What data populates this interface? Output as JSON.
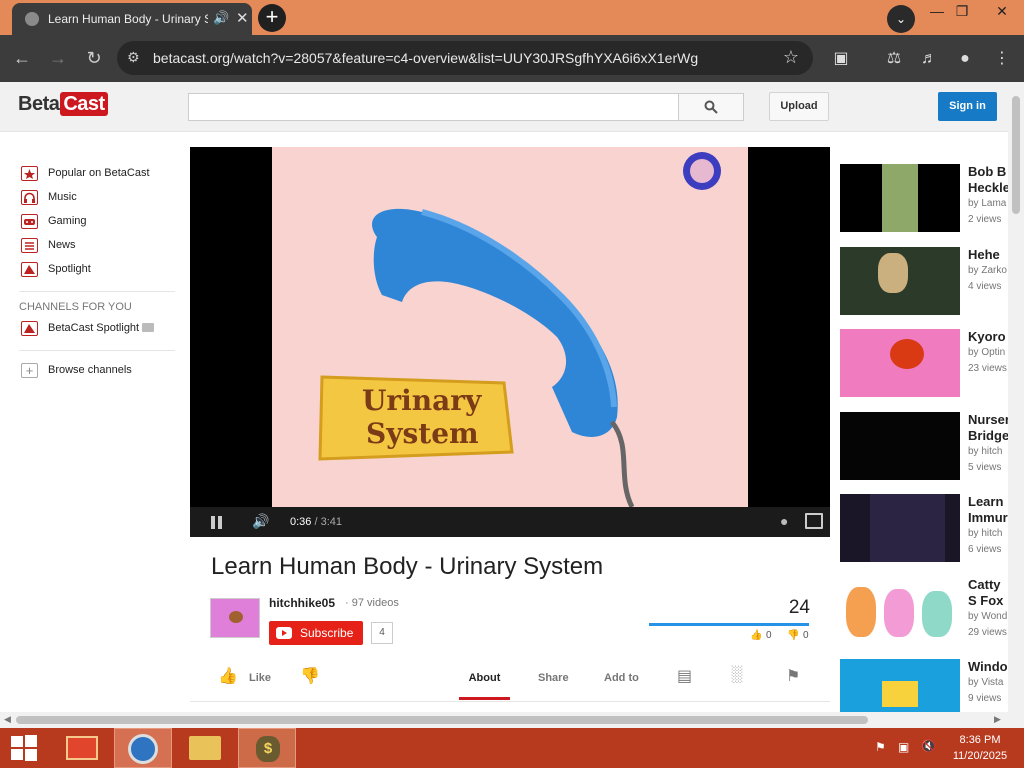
{
  "browser": {
    "tab_title": "Learn Human Body - Urinary System",
    "url": "betacast.org/watch?v=28057&feature=c4-overview&list=UUY30JRSgfhYXA6i6xX1erWg"
  },
  "site": {
    "logo_beta": "Beta",
    "logo_cast": "Cast",
    "upload_label": "Upload",
    "signin_label": "Sign in",
    "search_placeholder": ""
  },
  "guide": {
    "items": [
      {
        "label": "Popular on BetaCast",
        "icon": "star-icon"
      },
      {
        "label": "Music",
        "icon": "headphones-icon"
      },
      {
        "label": "Gaming",
        "icon": "gamepad-icon"
      },
      {
        "label": "News",
        "icon": "newspaper-icon"
      },
      {
        "label": "Spotlight",
        "icon": "spotlight-icon"
      }
    ],
    "channels_header": "CHANNELS FOR YOU",
    "channel": "BetaCast Spotlight",
    "browse": "Browse channels"
  },
  "player": {
    "current_time": "0:36",
    "duration": "3:41",
    "progress_percent": 16.3,
    "video_text_line1": "Urinary",
    "video_text_line2": "System"
  },
  "video": {
    "title": "Learn Human Body - Urinary System",
    "channel": "hitchhike05",
    "video_count": "97 videos",
    "subscribe_label": "Subscribe",
    "subscriber_count": "4",
    "views": "24",
    "likes": "0",
    "dislikes": "0",
    "like_label": "Like",
    "tabs": {
      "about": "About",
      "share": "Share",
      "add_to": "Add to"
    }
  },
  "related": [
    {
      "title": "Bob B Heckle",
      "author": "by Lama",
      "views": "2 views"
    },
    {
      "title": "Hehe",
      "author": "by Zarko",
      "views": "4 views"
    },
    {
      "title": "Kyoro",
      "author": "by Optin",
      "views": "23 views"
    },
    {
      "title": "Nurser Bridge",
      "author": "by hitch",
      "views": "5 views"
    },
    {
      "title": "Learn Immur",
      "author": "by hitch",
      "views": "6 views"
    },
    {
      "title": "Catty S Fox ar",
      "author": "by Wond",
      "views": "29 views"
    },
    {
      "title": "Windo",
      "author": "by Vista",
      "views": "9 views"
    }
  ],
  "taskbar": {
    "time": "8:36 PM",
    "date": "11/20/2025"
  }
}
